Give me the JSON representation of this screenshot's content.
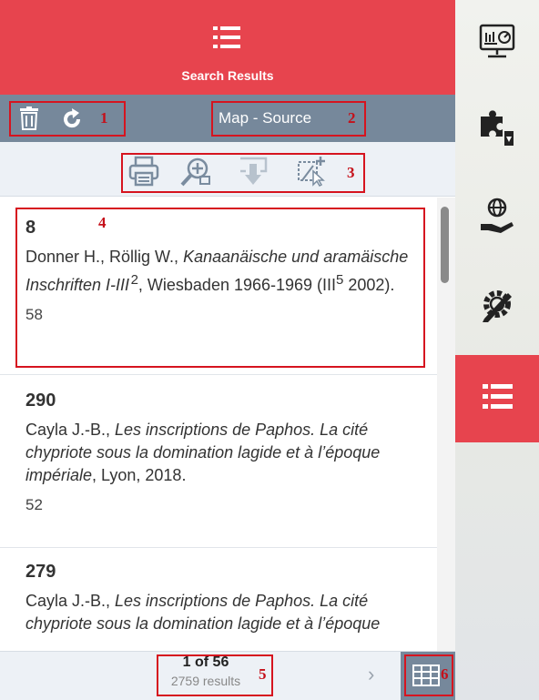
{
  "header": {
    "title": "Search Results",
    "icon": "list-icon"
  },
  "toolbar": {
    "annotation_1": "1",
    "annotation_2": "2",
    "map_source_label": "Map - Source",
    "actions": [
      "trash-icon",
      "refresh-icon"
    ]
  },
  "tools": {
    "annotation_3": "3",
    "icons": [
      "print-icon",
      "zoom-in-icon",
      "download-icon",
      "add-selection-icon"
    ]
  },
  "results": [
    {
      "number": "8",
      "annotation": "4",
      "authors": "Donner H., Röllig W., ",
      "title": "Kanaanäische und aramäische Inschriften I-III",
      "title_sup": "2",
      "rest1": ", Wiesbaden 1966-1969 (III",
      "rest_sup": "5",
      "rest2": " 2002).",
      "count": "58"
    },
    {
      "number": "290",
      "authors": "Cayla J.-B., ",
      "title": "Les inscriptions de Paphos. La cité chypriote sous la domination lagide et à l’époque impériale",
      "rest": ", Lyon, 2018.",
      "count": "52"
    },
    {
      "number": "279",
      "authors": "Cayla J.-B., ",
      "title": "Les inscriptions de Paphos. La cité chypriote sous la domination lagide et à l’époque",
      "rest": "",
      "count": ""
    }
  ],
  "footer": {
    "page_info": "1 of 56",
    "results_info": "2759 results",
    "annotation_5": "5",
    "annotation_6": "6",
    "next_label": "›"
  },
  "sidebar": {
    "items": [
      "monitor-chart-icon",
      "puzzle-icon",
      "globe-hand-icon",
      "gear-pencil-icon",
      "list-icon"
    ],
    "active": "list-icon"
  },
  "colors": {
    "header": "#e7444e",
    "toolbar": "#76889b",
    "toolbar_light": "#edf1f6",
    "annotation": "#d6141f",
    "sidebar_active": "#e7444e"
  }
}
